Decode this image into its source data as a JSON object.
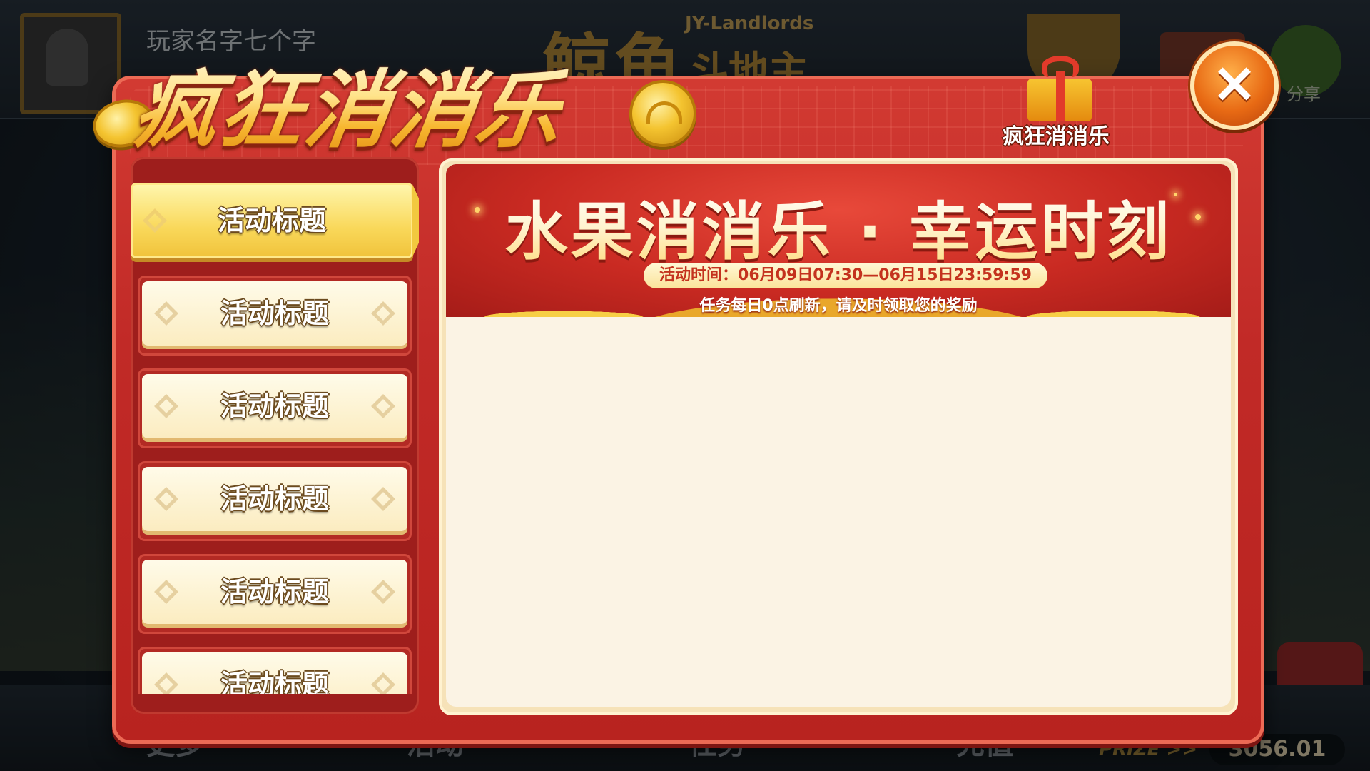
{
  "background": {
    "player_name": "玩家名字七个字",
    "logo_cn": "鲸鱼",
    "logo_en": "JY-Landlords",
    "logo_sub": "斗地主",
    "share_label": "分享",
    "bottom_items": [
      "更多",
      "活动",
      "任务",
      "充值"
    ],
    "prize_label": "PRIZE >>",
    "prize_amount": "3056.01"
  },
  "dialog": {
    "title": "疯狂消消乐",
    "gift_label": "疯狂消消乐",
    "close_icon": "×"
  },
  "sidebar": {
    "items": [
      {
        "label": "活动标题",
        "active": true
      },
      {
        "label": "活动标题",
        "active": false
      },
      {
        "label": "活动标题",
        "active": false
      },
      {
        "label": "活动标题",
        "active": false
      },
      {
        "label": "活动标题",
        "active": false
      },
      {
        "label": "活动标题",
        "active": false
      }
    ]
  },
  "banner": {
    "title": "水果消消乐 · 幸运时刻",
    "time": "活动时间：06月09日07:30—06月15日23:59:59",
    "note": "任务每日0点刷新，请及时领取您的奖励"
  },
  "colors": {
    "dialog_red": "#c12a27",
    "gold": "#f4c430",
    "cream": "#fbf3e4"
  }
}
